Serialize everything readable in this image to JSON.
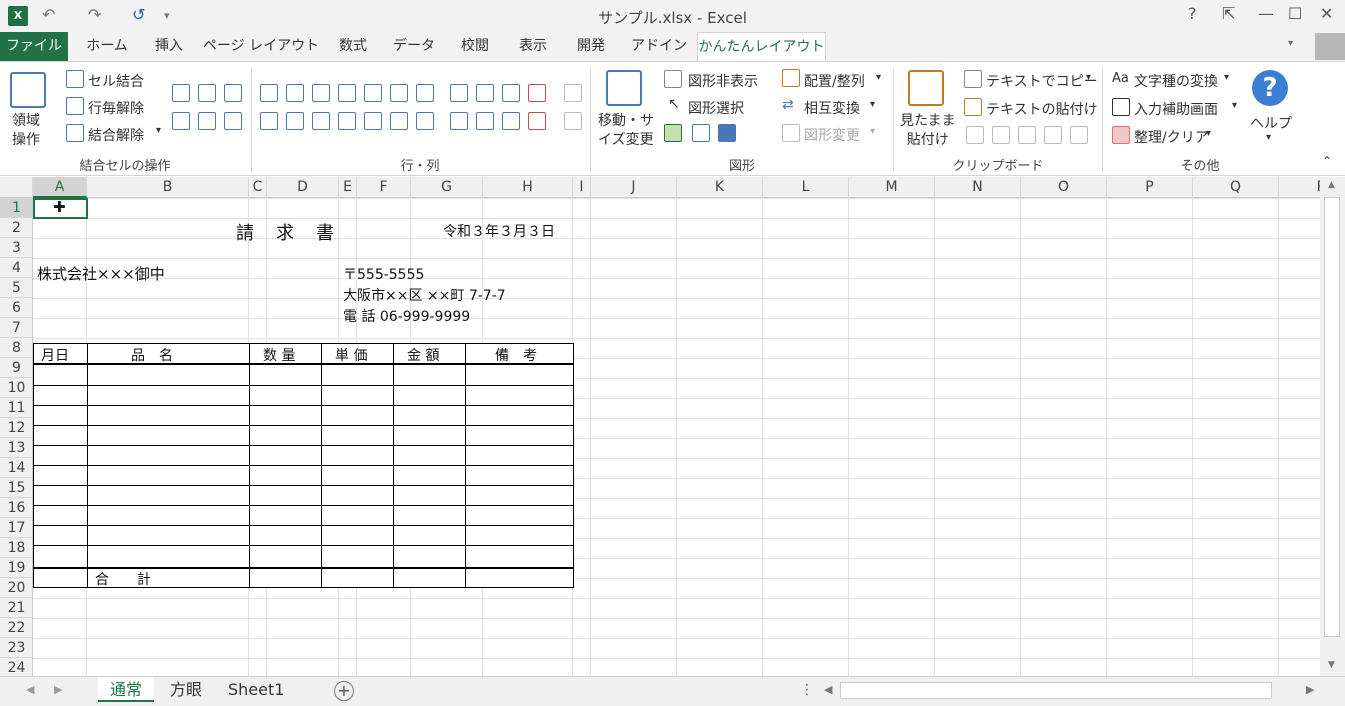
{
  "window": {
    "title": "サンプル.xlsx - Excel"
  },
  "tabs": [
    "ファイル",
    "ホーム",
    "挿入",
    "ページ レイアウト",
    "数式",
    "データ",
    "校閲",
    "表示",
    "開発",
    "アドイン",
    "かんたんレイアウト"
  ],
  "ribbon": {
    "merge": {
      "big_label": "領域\n操作",
      "cell_merge": "セル結合",
      "row_split": "行毎解除",
      "merge_split": "結合解除",
      "group": "結合セルの操作"
    },
    "rowcol": {
      "group": "行・列"
    },
    "shape": {
      "move_resize": "移動・サ\nイズ変更",
      "hide": "図形非表示",
      "select": "図形選択",
      "arrange": "配置/整列",
      "swap": "相互変換",
      "change": "図形変更",
      "group": "図形"
    },
    "clipboard": {
      "paste_visible": "見たまま\n貼付け",
      "copy_text": "テキストでコピー",
      "paste_text": "テキストの貼付け",
      "group": "クリップボード"
    },
    "other": {
      "char_convert": "文字種の変換",
      "input_screen": "入力補助画面",
      "cleanup": "整理/クリア",
      "help": "ヘルプ",
      "group": "その他"
    }
  },
  "columns": [
    "A",
    "B",
    "C",
    "D",
    "E",
    "F",
    "G",
    "H",
    "I",
    "J",
    "K",
    "L",
    "M",
    "N",
    "O",
    "P",
    "Q",
    "R"
  ],
  "rows": [
    "1",
    "2",
    "3",
    "4",
    "5",
    "6",
    "7",
    "8",
    "9",
    "10",
    "11",
    "12",
    "13",
    "14",
    "15",
    "16",
    "17",
    "18",
    "19",
    "20",
    "21",
    "22",
    "23",
    "24"
  ],
  "sheet": {
    "title": "請　求　書",
    "date": "令和３年３月３日",
    "customer": "株式会社×××御中",
    "zip": "〒555-5555",
    "address": "大阪市××区 ××町 7-7-7",
    "phone": "電 話  06-999-9999",
    "headers": [
      "月日",
      "品　名",
      "数 量",
      "単 価",
      "金 額",
      "備　考"
    ],
    "total_label": "合　　計"
  },
  "sheet_tabs": [
    "通常",
    "方眼",
    "Sheet1"
  ]
}
